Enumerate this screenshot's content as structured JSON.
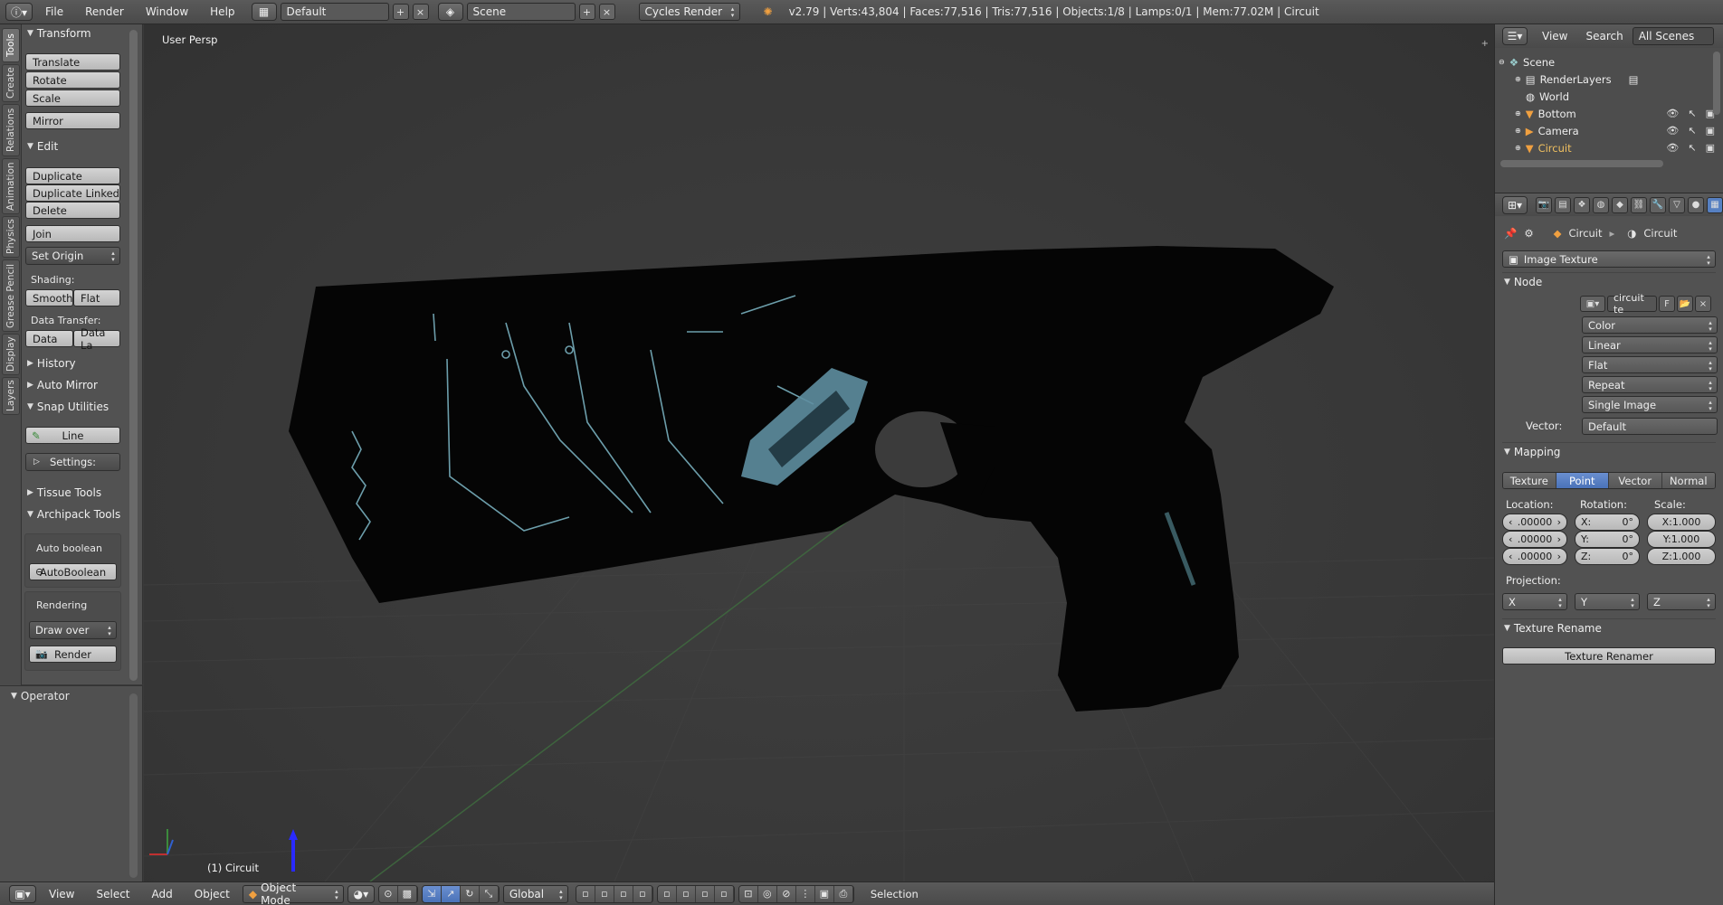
{
  "topbar": {
    "menus": [
      "File",
      "Render",
      "Window",
      "Help"
    ],
    "layout": "Default",
    "scene": "Scene",
    "engine": "Cycles Render",
    "stats": "v2.79 | Verts:43,804 | Faces:77,516 | Tris:77,516 | Objects:1/8 | Lamps:0/1 | Mem:77.02M | Circuit"
  },
  "tabs": [
    "Tools",
    "Create",
    "Relations",
    "Animation",
    "Physics",
    "Grease Pencil",
    "Display",
    "Layers"
  ],
  "toolshelf": {
    "transform": {
      "title": "Transform",
      "buttons": [
        "Translate",
        "Rotate",
        "Scale",
        "Mirror"
      ]
    },
    "edit": {
      "title": "Edit",
      "buttons": [
        "Duplicate",
        "Duplicate Linked",
        "Delete",
        "Join"
      ],
      "set_origin": "Set Origin",
      "shading_label": "Shading:",
      "smooth": "Smooth",
      "flat": "Flat",
      "data_transfer_label": "Data Transfer:",
      "data": "Data",
      "data_la": "Data La"
    },
    "history": "History",
    "auto_mirror": "Auto Mirror",
    "snap": {
      "title": "Snap Utilities",
      "line": "Line",
      "settings": "Settings:"
    },
    "tissue": "Tissue Tools",
    "archipack": {
      "title": "Archipack Tools",
      "auto_boolean": "Auto boolean",
      "autoboolean_btn": "AutoBoolean",
      "rendering": "Rendering",
      "draw_over": "Draw over",
      "render": "Render"
    },
    "operator": "Operator"
  },
  "viewport": {
    "title": "User Persp",
    "object": "(1) Circuit"
  },
  "bottombar": {
    "menus": [
      "View",
      "Select",
      "Add",
      "Object"
    ],
    "mode": "Object Mode",
    "orientation": "Global",
    "selection": "Selection"
  },
  "outliner": {
    "header": {
      "view": "View",
      "search": "Search",
      "filter": "All Scenes"
    },
    "rows": [
      "Scene",
      "RenderLayers",
      "World",
      "Bottom",
      "Camera",
      "Circuit"
    ]
  },
  "properties": {
    "breadcrumb": [
      "Circuit",
      "Circuit"
    ],
    "texture_type": "Image Texture",
    "node": {
      "title": "Node",
      "image": "circuit te",
      "image_flag": "F",
      "color": "Color",
      "interp": "Linear",
      "proj": "Flat",
      "ext": "Repeat",
      "source": "Single Image",
      "vector_label": "Vector:",
      "vector": "Default"
    },
    "mapping": {
      "title": "Mapping",
      "tabs": [
        "Texture",
        "Point",
        "Vector",
        "Normal"
      ],
      "active": "Point",
      "location_label": "Location:",
      "rotation_label": "Rotation:",
      "scale_label": "Scale:",
      "location": [
        ".00000",
        ".00000",
        ".00000"
      ],
      "rotation": [
        {
          "axis": "X:",
          "val": "0°"
        },
        {
          "axis": "Y:",
          "val": "0°"
        },
        {
          "axis": "Z:",
          "val": "0°"
        }
      ],
      "scale": [
        "X:1.000",
        "Y:1.000",
        "Z:1.000"
      ],
      "projection_label": "Projection:",
      "projection": [
        "X",
        "Y",
        "Z"
      ]
    },
    "rename": {
      "title": "Texture Rename",
      "button": "Texture Renamer"
    }
  }
}
